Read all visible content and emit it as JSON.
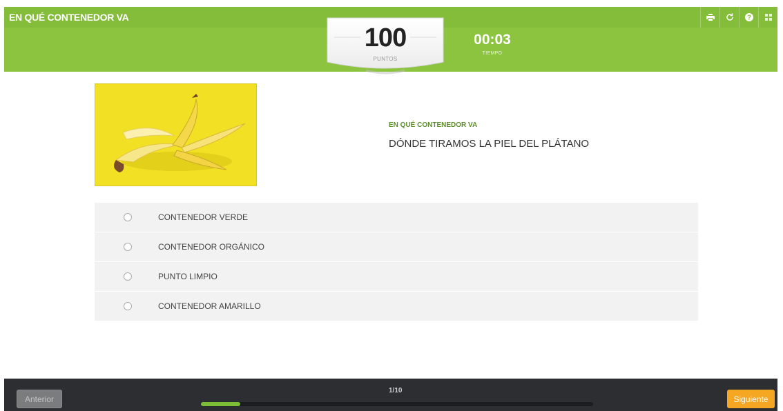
{
  "header": {
    "title": "EN QUÉ CONTENEDOR VA",
    "icons": [
      "print-icon",
      "restart-icon",
      "help-icon",
      "grid-icon"
    ]
  },
  "score": {
    "value": "100",
    "label": "PUNTOS"
  },
  "timer": {
    "value": "00:03",
    "label": "TIEMPO"
  },
  "question": {
    "category": "EN QUÉ CONTENEDOR VA",
    "text": "DÓNDE TIRAMOS LA PIEL DEL PLÁTANO",
    "image": "banana-peel-image"
  },
  "options": [
    {
      "label": "CONTENEDOR VERDE"
    },
    {
      "label": "CONTENEDOR ORGÁNICO"
    },
    {
      "label": "PUNTO LIMPIO"
    },
    {
      "label": "CONTENEDOR AMARILLO"
    }
  ],
  "footer": {
    "prev_label": "Anterior",
    "next_label": "Siguiente",
    "progress_text": "1/10",
    "progress_fraction": 0.1
  },
  "colors": {
    "accent_green": "#8cc43f",
    "next_button": "#f5a623",
    "footer_bg": "#2c2e31"
  }
}
